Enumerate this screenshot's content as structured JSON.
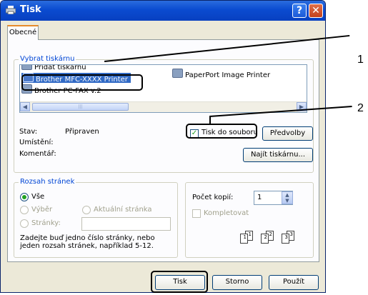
{
  "window": {
    "title": "Tisk"
  },
  "tabs": [
    {
      "label": "Obecné"
    }
  ],
  "select_printer": {
    "legend": "Vybrat tiskárnu",
    "items": [
      "Přidat tiskárnu",
      "Brother MFC-XXXX   Printer",
      "Brother PC-FAX v.2",
      "PaperPort Image Printer"
    ],
    "selected": "Brother MFC-XXXX   Printer"
  },
  "status": {
    "status_label": "Stav:",
    "status_value": "Připraven",
    "location_label": "Umístění:",
    "comment_label": "Komentář:",
    "print_to_file_label": "Tisk do souboru",
    "print_to_file_checked": true,
    "preferences_button": "Předvolby",
    "find_printer_button": "Najít tiskárnu..."
  },
  "page_range": {
    "legend": "Rozsah stránek",
    "all_label": "Vše",
    "selection_label": "Výběr",
    "current_page_label": "Aktuální stránka",
    "pages_label": "Stránky:",
    "pages_value": "",
    "hint": "Zadejte buď jedno číslo stránky, nebo jeden rozsah stránek, například 5-12."
  },
  "copies": {
    "count_label": "Počet kopií:",
    "count_value": "1",
    "collate_label": "Kompletovat",
    "collate_checked": false
  },
  "buttons": {
    "print": "Tisk",
    "cancel": "Storno",
    "apply": "Použít"
  },
  "callouts": [
    "1",
    "2"
  ],
  "colors": {
    "titlebar": "#0a4bd0",
    "selection": "#316ac5",
    "legend_text": "#0046d5"
  }
}
